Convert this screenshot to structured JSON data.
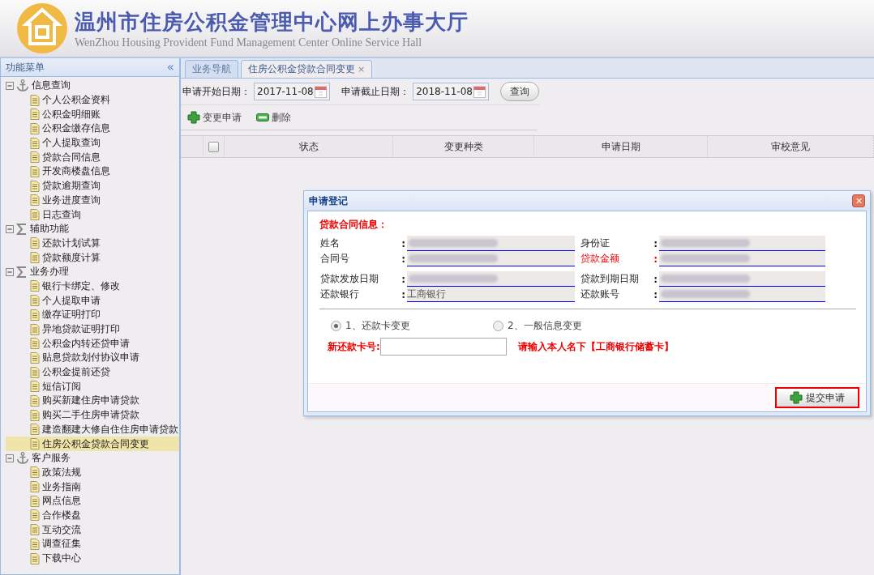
{
  "header": {
    "title": "温州市住房公积金管理中心网上办事大厅",
    "subtitle": "WenZhou Housing Provident Fund Management Center Online Service Hall"
  },
  "sidebar": {
    "title": "功能菜单",
    "collapse": "«",
    "groups": [
      {
        "label": "信息查询",
        "kind": "anchor",
        "expanded": true,
        "children": [
          {
            "label": "个人公积金资料",
            "selected": false
          },
          {
            "label": "公积金明细账",
            "selected": false
          },
          {
            "label": "公积金缴存信息",
            "selected": false
          },
          {
            "label": "个人提取查询",
            "selected": false
          },
          {
            "label": "贷款合同信息",
            "selected": false
          },
          {
            "label": "开发商楼盘信息",
            "selected": false
          },
          {
            "label": "贷款逾期查询",
            "selected": false
          },
          {
            "label": "业务进度查询",
            "selected": false
          },
          {
            "label": "日志查询",
            "selected": false
          }
        ]
      },
      {
        "label": "辅助功能",
        "kind": "sigma",
        "expanded": true,
        "children": [
          {
            "label": "还款计划试算",
            "selected": false
          },
          {
            "label": "贷款额度计算",
            "selected": false
          }
        ]
      },
      {
        "label": "业务办理",
        "kind": "sigma",
        "expanded": true,
        "children": [
          {
            "label": "银行卡绑定、修改",
            "selected": false
          },
          {
            "label": "个人提取申请",
            "selected": false
          },
          {
            "label": "缴存证明打印",
            "selected": false
          },
          {
            "label": "异地贷款证明打印",
            "selected": false
          },
          {
            "label": "公积金内转还贷申请",
            "selected": false
          },
          {
            "label": "贴息贷款划付协议申请",
            "selected": false
          },
          {
            "label": "公积金提前还贷",
            "selected": false
          },
          {
            "label": "短信订阅",
            "selected": false
          },
          {
            "label": "购买新建住房申请贷款",
            "selected": false
          },
          {
            "label": "购买二手住房申请贷款",
            "selected": false
          },
          {
            "label": "建造翻建大修自住住房申请贷款",
            "selected": false
          },
          {
            "label": "住房公积金贷款合同变更",
            "selected": true
          }
        ]
      },
      {
        "label": "客户服务",
        "kind": "anchor",
        "expanded": true,
        "children": [
          {
            "label": "政策法规",
            "selected": false
          },
          {
            "label": "业务指南",
            "selected": false
          },
          {
            "label": "网点信息",
            "selected": false
          },
          {
            "label": "合作楼盘",
            "selected": false
          },
          {
            "label": "互动交流",
            "selected": false
          },
          {
            "label": "调查征集",
            "selected": false
          },
          {
            "label": "下载中心",
            "selected": false
          }
        ]
      }
    ]
  },
  "tabs": [
    {
      "label": "业务导航",
      "selected": false
    },
    {
      "label": "住房公积金贷款合同变更",
      "selected": true,
      "close": "×"
    }
  ],
  "filters": [
    {
      "label": "申请开始日期：",
      "value": "2017-11-08"
    },
    {
      "label": "申请截止日期：",
      "value": "2018-11-08"
    }
  ],
  "query_button": "查询",
  "actions": [
    {
      "label": "变更申请",
      "kind": "add"
    },
    {
      "label": "删除",
      "kind": "remove"
    }
  ],
  "table": {
    "checked": false,
    "columns": [
      "状态",
      "变更种类",
      "申请日期",
      "审校意见"
    ]
  },
  "dialog": {
    "title": "申请登记",
    "close": "✕",
    "section": "贷款合同信息：",
    "fields": [
      {
        "label": "姓名",
        "colon": ":",
        "redacted": true,
        "required": false
      },
      {
        "label": "身份证",
        "colon": ":",
        "redacted": true,
        "required": false
      },
      {
        "label": "合同号",
        "colon": ":",
        "redacted": true,
        "required": false
      },
      {
        "label": "贷款金额",
        "colon": ":",
        "redacted": true,
        "required": true
      },
      {
        "label": "贷款发放日期",
        "colon": ":",
        "redacted": true,
        "required": false
      },
      {
        "label": "贷款到期日期",
        "colon": ":",
        "redacted": true,
        "required": false
      },
      {
        "label": "还款银行",
        "colon": ":",
        "value": "工商银行",
        "redacted": false,
        "required": false
      },
      {
        "label": "还款账号",
        "colon": ":",
        "redacted": true,
        "required": false
      }
    ],
    "options": [
      {
        "label": "1、还款卡变更",
        "selected": true
      },
      {
        "label": "2、一般信息变更",
        "selected": false
      }
    ],
    "card_label": "新还款卡号:",
    "card_hint": "请输入本人名下【工商银行储蓄卡】",
    "submit": {
      "label": "提交申请",
      "focused": true
    }
  }
}
